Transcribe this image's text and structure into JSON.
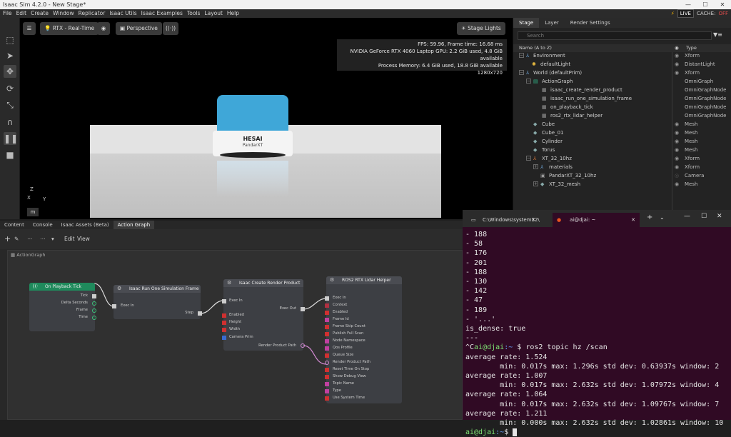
{
  "window": {
    "title": "Isaac Sim 4.2.0 - New Stage*",
    "live": "LIVE",
    "cache_label": "CACHE:",
    "cache_state": "OFF"
  },
  "menu": [
    "File",
    "Edit",
    "Create",
    "Window",
    "Replicator",
    "Isaac Utils",
    "Isaac Examples",
    "Tools",
    "Layout",
    "Help"
  ],
  "viewport": {
    "renderer": "RTX - Real-Time",
    "camera": "Perspective",
    "lights": "Stage Lights",
    "stats": [
      "FPS: 59.96, Frame time: 16.68 ms",
      "NVIDIA GeForce RTX 4060 Laptop GPU: 2.2 GiB used, 4.8 GiB available",
      "Process Memory: 6.4 GiB used, 18.8 GiB available",
      "1280x720"
    ],
    "lidar_brand": "HESAI",
    "lidar_model": "PandarXT",
    "axis_z": "Z",
    "axis_x": "X",
    "axis_y": "Y",
    "units": "m"
  },
  "stage": {
    "tabs": [
      "Stage",
      "Layer",
      "Render Settings"
    ],
    "search_placeholder": "Search",
    "col_name": "Name (A to Z)",
    "col_type": "Type",
    "rows": [
      {
        "name": "Environment",
        "type": "Xform"
      },
      {
        "name": "defaultLight",
        "type": "DistantLight"
      },
      {
        "name": "World (defaultPrim)",
        "type": "Xform"
      },
      {
        "name": "ActionGraph",
        "type": "OmniGraph"
      },
      {
        "name": "isaac_create_render_product",
        "type": "OmniGraphNode"
      },
      {
        "name": "isaac_run_one_simulation_frame",
        "type": "OmniGraphNode"
      },
      {
        "name": "on_playback_tick",
        "type": "OmniGraphNode"
      },
      {
        "name": "ros2_rtx_lidar_helper",
        "type": "OmniGraphNode"
      },
      {
        "name": "Cube",
        "type": "Mesh"
      },
      {
        "name": "Cube_01",
        "type": "Mesh"
      },
      {
        "name": "Cylinder",
        "type": "Mesh"
      },
      {
        "name": "Torus",
        "type": "Mesh"
      },
      {
        "name": "XT_32_10hz",
        "type": "Xform"
      },
      {
        "name": "materials",
        "type": "Xform"
      },
      {
        "name": "PandarXT_32_10hz",
        "type": "Camera"
      },
      {
        "name": "XT_32_mesh",
        "type": "Mesh"
      }
    ]
  },
  "bottom_tabs": [
    "Content",
    "Console",
    "Isaac Assets (Beta)",
    "Action Graph"
  ],
  "graph": {
    "menu_edit": "Edit",
    "menu_view": "View",
    "title": "ActionGraph",
    "nodes": {
      "tick": {
        "title": "On Playback Tick",
        "ports": [
          "Tick",
          "Delta Seconds",
          "Frame",
          "Time"
        ]
      },
      "run": {
        "title": "Isaac Run One Simulation Frame",
        "in": "Exec In",
        "out": "Step"
      },
      "render": {
        "title": "Isaac Create Render Product",
        "in": [
          "Exec In",
          "Enabled",
          "Height",
          "Width",
          "Camera Prim"
        ],
        "out": [
          "Exec Out",
          "Render Product Path"
        ]
      },
      "lidar": {
        "title": "ROS2 RTX Lidar Helper",
        "ports": [
          "Exec In",
          "Context",
          "Enabled",
          "Frame Id",
          "Frame Skip Count",
          "Publish Full Scan",
          "Node Namespace",
          "Qos Profile",
          "Queue Size",
          "Render Product Path",
          "Reset Time On Stop",
          "Show Debug View",
          "Topic Name",
          "Type",
          "Use System Time"
        ]
      }
    }
  },
  "terminal": {
    "tab1": "C:\\Windows\\system32\\",
    "tab2": "ai@djai: ~",
    "lines": [
      "- 188",
      "- 58",
      "- 176",
      "- 201",
      "- 188",
      "- 130",
      "- 142",
      "- 47",
      "- 189",
      "- '...'",
      "is_dense: true",
      "---"
    ],
    "cmd_prefix": "^C",
    "user": "ai@djai",
    "path": ":~",
    "cmd": "$ ros2 topic hz /scan",
    "stats": [
      "average rate: 1.524",
      "        min: 0.017s max: 1.296s std dev: 0.63937s window: 2",
      "average rate: 1.007",
      "        min: 0.017s max: 2.632s std dev: 1.07972s window: 4",
      "average rate: 1.064",
      "        min: 0.017s max: 2.632s std dev: 1.09767s window: 7",
      "average rate: 1.211",
      "        min: 0.000s max: 2.632s std dev: 1.02861s window: 10"
    ],
    "end_prompt": "$"
  },
  "colors": {
    "accent_green": "#1f8a5c",
    "lidar_blue": "#3fa7d8",
    "terminal_bg": "#300a24"
  }
}
